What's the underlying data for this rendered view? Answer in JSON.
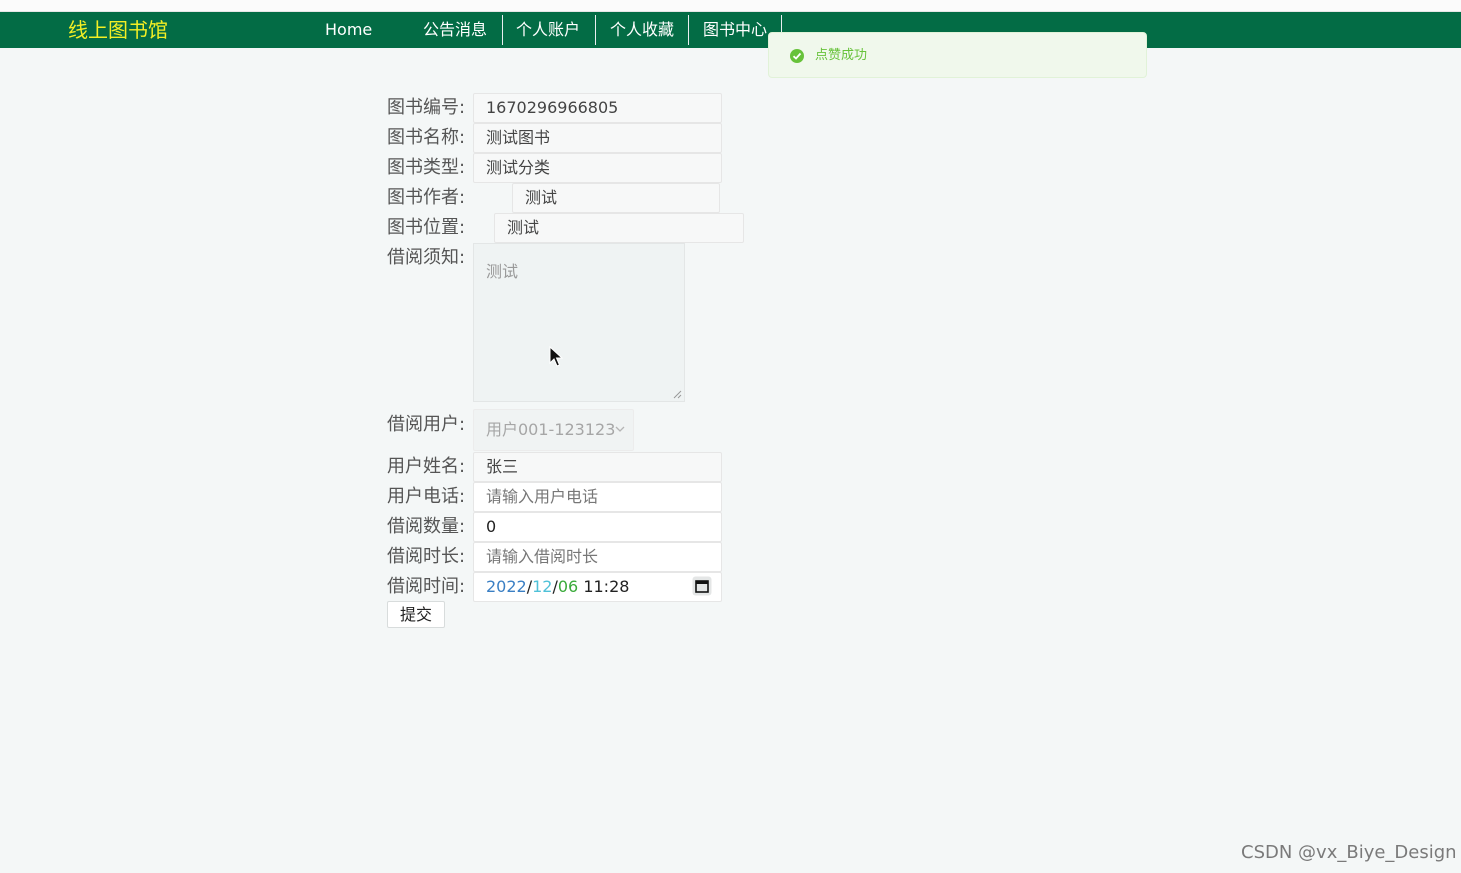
{
  "header": {
    "brand": "线上图书馆",
    "nav": [
      {
        "label": "Home"
      },
      {
        "label": "公告消息"
      },
      {
        "label": "个人账户"
      },
      {
        "label": "个人收藏"
      },
      {
        "label": "图书中心"
      }
    ]
  },
  "toast": {
    "message": "点赞成功",
    "color": "#67c23a"
  },
  "form": {
    "book_no": {
      "label": "图书编号:",
      "value": "1670296966805"
    },
    "book_name": {
      "label": "图书名称:",
      "value": "测试图书"
    },
    "book_type": {
      "label": "图书类型:",
      "value": "测试分类"
    },
    "book_author": {
      "label": "图书作者:",
      "value": "测试"
    },
    "book_location": {
      "label": "图书位置:",
      "value": "测试"
    },
    "borrow_notice": {
      "label": "借阅须知:",
      "value": "测试"
    },
    "borrow_user": {
      "label": "借阅用户:",
      "value": "用户001-123123"
    },
    "user_name": {
      "label": "用户姓名:",
      "value": "张三"
    },
    "user_phone": {
      "label": "用户电话:",
      "placeholder": "请输入用户电话"
    },
    "borrow_qty": {
      "label": "借阅数量:",
      "value": "0"
    },
    "borrow_duration": {
      "label": "借阅时长:",
      "placeholder": "请输入借阅时长"
    },
    "borrow_time": {
      "label": "借阅时间:",
      "year": "2022",
      "month": "12",
      "day": "06",
      "time": "11:28",
      "sep": "/"
    },
    "submit_label": "提交"
  },
  "colors": {
    "navbar": "#036c45",
    "brand": "#f3ef24",
    "year": "#3a7fc4",
    "month": "#4fc1d8",
    "day": "#3aaa3a"
  },
  "watermark": "CSDN @vx_Biye_Design"
}
